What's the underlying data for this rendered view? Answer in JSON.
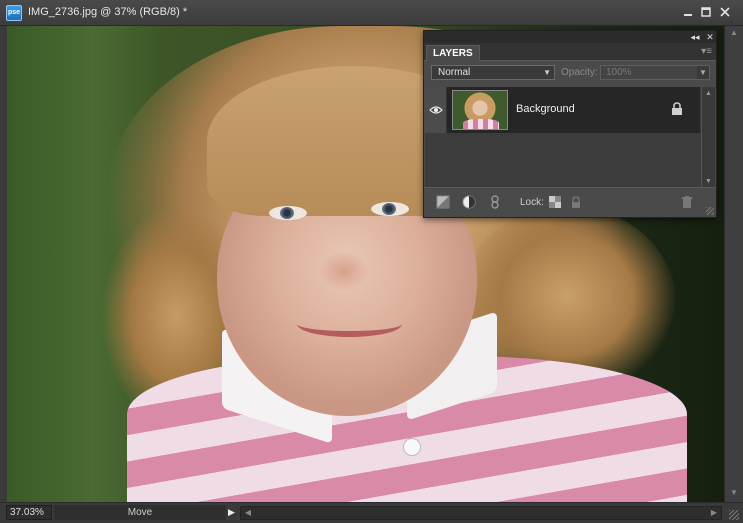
{
  "window": {
    "app_icon_text": "pse",
    "document_title": "IMG_2736.jpg @ 37% (RGB/8) *",
    "minimize_icon": "minimize-icon",
    "maximize_icon": "maximize-icon",
    "close_icon": "close-icon"
  },
  "layers_panel": {
    "collapse_icon": "double-chevron-left-icon",
    "close_icon": "close-icon",
    "tab_label": "LAYERS",
    "menu_icon": "panel-menu-icon",
    "blend_mode": "Normal",
    "opacity_label": "Opacity:",
    "opacity_value": "100%",
    "layers": [
      {
        "name": "Background",
        "visible": true,
        "locked": true
      }
    ],
    "lock_label": "Lock:"
  },
  "statusbar": {
    "zoom": "37.03%",
    "tool": "Move"
  }
}
